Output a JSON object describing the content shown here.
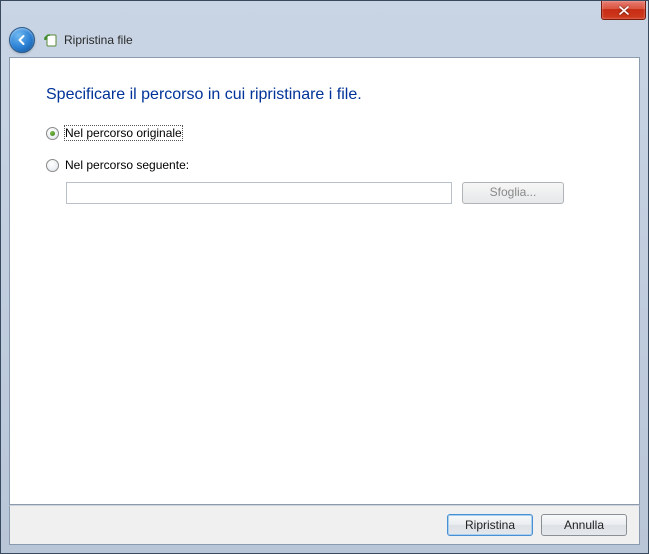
{
  "window": {
    "wizard_title": "Ripristina file"
  },
  "content": {
    "heading": "Specificare il percorso in cui ripristinare i file.",
    "radio_original": "Nel percorso originale",
    "radio_following": "Nel percorso seguente:",
    "path_value": "",
    "browse_label": "Sfoglia..."
  },
  "footer": {
    "restore": "Ripristina",
    "cancel": "Annulla"
  }
}
